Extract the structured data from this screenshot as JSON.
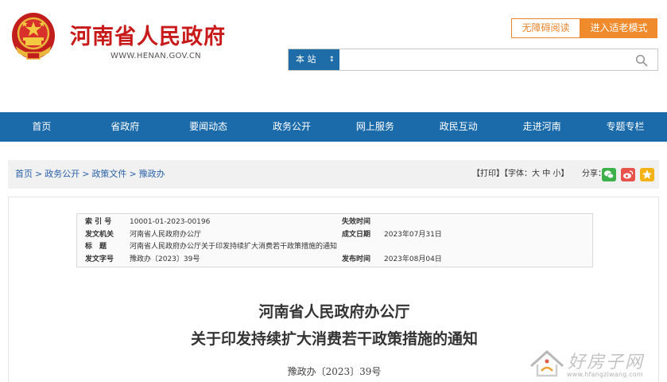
{
  "header": {
    "site_title": "河南省人民政府",
    "site_domain": "WWW.HENAN.GOV.CN",
    "btn_accessible": "无障碍阅读",
    "btn_elder": "进入适老模式",
    "search_scope": "本 站",
    "search_placeholder": ""
  },
  "nav": {
    "items": [
      "首页",
      "省政府",
      "要闻动态",
      "政务公开",
      "网上服务",
      "政民互动",
      "走进河南",
      "专题专栏"
    ]
  },
  "breadcrumb": {
    "items": [
      "首页",
      "政务公开",
      "政策文件",
      "豫政办"
    ],
    "sep": ">"
  },
  "tools": {
    "print": "【打印】",
    "font_prefix": "【字体：",
    "font_large": "大",
    "font_medium": "中",
    "font_small": "小",
    "font_suffix": "】",
    "share_label": "分享："
  },
  "meta": {
    "index_label": "索 引 号",
    "index_value": "10001-01-2023-00196",
    "expire_label": "失效时间",
    "expire_value": "",
    "issuer_label": "发文机关",
    "issuer_value": "河南省人民政府办公厅",
    "date_label": "成文日期",
    "date_value": "2023年07月31日",
    "title_label": "标　题",
    "title_value": "河南省人民政府办公厅关于印发持续扩大消费若干政策措施的通知",
    "docno_label": "发文字号",
    "docno_value": "豫政办〔2023〕39号",
    "publish_label": "发布时间",
    "publish_value": "2023年08月04日"
  },
  "document": {
    "title_line1": "河南省人民政府办公厅",
    "title_line2": "关于印发持续扩大消费若干政策措施的通知",
    "number": "豫政办〔2023〕39号"
  },
  "watermark": {
    "text": "好房子网",
    "url": "www.hfangziwang.com"
  },
  "colors": {
    "brand_red": "#c81a1a",
    "nav_blue": "#1b6aaa",
    "accent_orange": "#ef8a2d"
  }
}
